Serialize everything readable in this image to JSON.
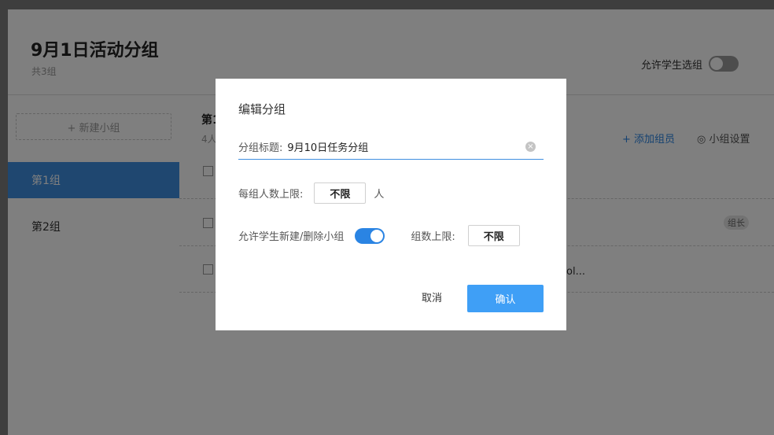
{
  "header": {
    "title": "9月1日活动分组",
    "subtitle": "共3组",
    "allow_label": "允许学生选组"
  },
  "sidebar": {
    "new_group": "+ 新建小组",
    "items": [
      {
        "label": "第1组"
      },
      {
        "label": "第2组"
      }
    ]
  },
  "main": {
    "group_head": "第1",
    "member_count": "4人",
    "add_member": "+ 添加组员",
    "settings_icon": "◎",
    "settings": "小组设置",
    "leader_badge": "组长",
    "truncated_text": "ol..."
  },
  "modal": {
    "title": "编辑分组",
    "name_label": "分组标题:",
    "name_value": "9月10日任务分组",
    "clear_icon": "×",
    "limit_label": "每组人数上限:",
    "limit_value": "不限",
    "limit_unit": "人",
    "allow_label": "允许学生新建/删除小组",
    "count_label": "组数上限:",
    "count_value": "不限",
    "cancel": "取消",
    "confirm": "确认"
  }
}
